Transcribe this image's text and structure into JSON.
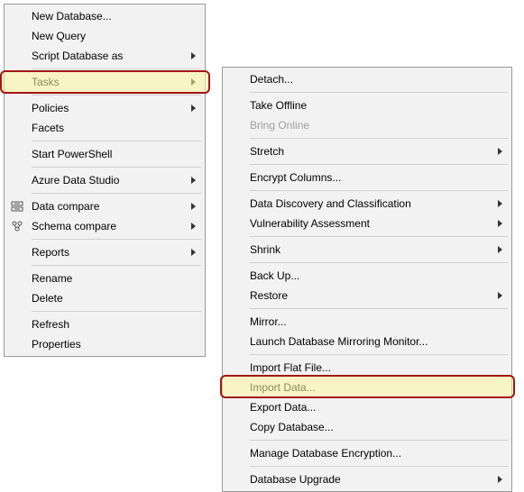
{
  "leftMenu": {
    "items": [
      {
        "label": "New Database..."
      },
      {
        "label": "New Query"
      },
      {
        "label": "Script Database as",
        "arrow": true
      },
      {
        "sep": true
      },
      {
        "label": "Tasks",
        "arrow": true,
        "highlight": true
      },
      {
        "sep": true
      },
      {
        "label": "Policies",
        "arrow": true
      },
      {
        "label": "Facets"
      },
      {
        "sep": true
      },
      {
        "label": "Start PowerShell"
      },
      {
        "sep": true
      },
      {
        "label": "Azure Data Studio",
        "arrow": true
      },
      {
        "sep": true
      },
      {
        "label": "Data compare",
        "arrow": true,
        "icon": "data-compare-icon"
      },
      {
        "label": "Schema compare",
        "arrow": true,
        "icon": "schema-compare-icon"
      },
      {
        "sep": true
      },
      {
        "label": "Reports",
        "arrow": true
      },
      {
        "sep": true
      },
      {
        "label": "Rename"
      },
      {
        "label": "Delete"
      },
      {
        "sep": true
      },
      {
        "label": "Refresh"
      },
      {
        "label": "Properties"
      }
    ]
  },
  "rightMenu": {
    "items": [
      {
        "label": "Detach..."
      },
      {
        "sep": true
      },
      {
        "label": "Take Offline"
      },
      {
        "label": "Bring Online",
        "disabled": true
      },
      {
        "sep": true
      },
      {
        "label": "Stretch",
        "arrow": true
      },
      {
        "sep": true
      },
      {
        "label": "Encrypt Columns..."
      },
      {
        "sep": true
      },
      {
        "label": "Data Discovery and Classification",
        "arrow": true
      },
      {
        "label": "Vulnerability Assessment",
        "arrow": true
      },
      {
        "sep": true
      },
      {
        "label": "Shrink",
        "arrow": true
      },
      {
        "sep": true
      },
      {
        "label": "Back Up..."
      },
      {
        "label": "Restore",
        "arrow": true
      },
      {
        "sep": true
      },
      {
        "label": "Mirror..."
      },
      {
        "label": "Launch Database Mirroring Monitor..."
      },
      {
        "sep": true
      },
      {
        "label": "Import Flat File..."
      },
      {
        "label": "Import Data...",
        "highlight": true
      },
      {
        "label": "Export Data..."
      },
      {
        "label": "Copy Database..."
      },
      {
        "sep": true
      },
      {
        "label": "Manage Database Encryption..."
      },
      {
        "sep": true
      },
      {
        "label": "Database Upgrade",
        "arrow": true
      }
    ]
  }
}
